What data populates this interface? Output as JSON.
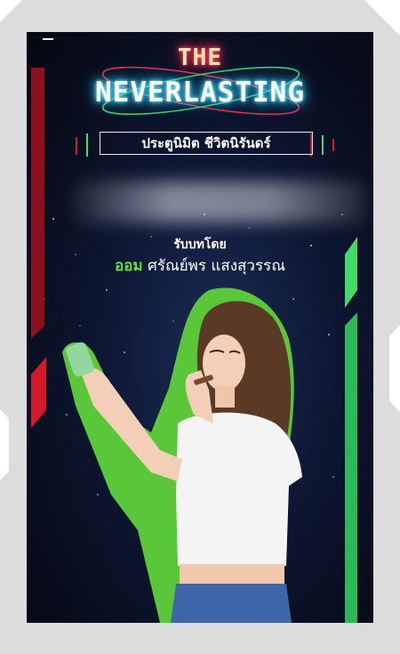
{
  "poster": {
    "title_top": "THE",
    "title_main": "NEVERLASTING",
    "subtitle": "ประตูนิมิต ชีวิตนิรันดร์",
    "credit_label": "รับบทโดย",
    "credit_first": "ออม",
    "credit_rest": "ศรัณย์พร แสงสุวรรณ"
  },
  "colors": {
    "frame": "#dcdcdc",
    "accent_green": "#6bdc3f",
    "accent_red": "#c8102e",
    "neon_cyan": "#31d8ff",
    "neon_pink": "#ff2d55"
  }
}
